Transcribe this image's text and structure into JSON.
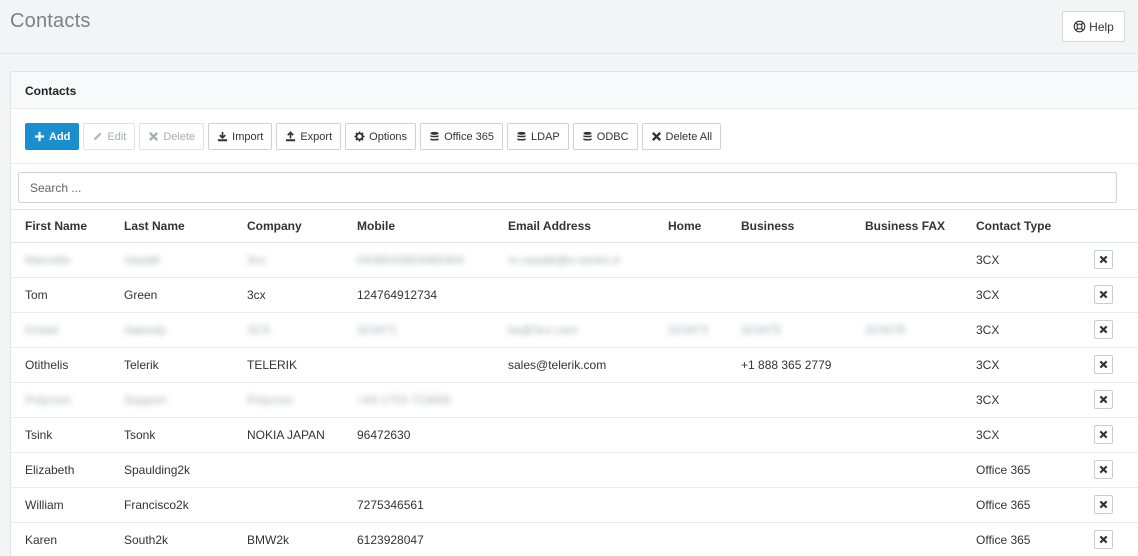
{
  "page": {
    "title": "Contacts",
    "help_label": "Help"
  },
  "panel": {
    "title": "Contacts"
  },
  "toolbar": {
    "add": "Add",
    "edit": "Edit",
    "delete": "Delete",
    "import": "Import",
    "export": "Export",
    "options": "Options",
    "office365": "Office 365",
    "ldap": "LDAP",
    "odbc": "ODBC",
    "delete_all": "Delete All"
  },
  "search": {
    "placeholder": "Search ..."
  },
  "table": {
    "columns": [
      "First Name",
      "Last Name",
      "Company",
      "Mobile",
      "Email Address",
      "Home",
      "Business",
      "Business FAX",
      "Contact Type"
    ],
    "rows": [
      {
        "blurred": true,
        "cells": [
          "Marcello",
          "Vasatti",
          "3cx",
          "0438543653465464",
          "m.vasatti@e-works.it",
          "",
          "",
          "",
          "3CX"
        ]
      },
      {
        "blurred": false,
        "cells": [
          "Tom",
          "Green",
          "3cx",
          "124764912734",
          "",
          "",
          "",
          "",
          "3CX"
        ]
      },
      {
        "blurred": true,
        "cells": [
          "Kristel",
          "Aakesly",
          "3CX",
          "323471",
          "ka@3cx.com",
          "323473",
          "323475",
          "323478",
          "3CX"
        ]
      },
      {
        "blurred": false,
        "cells": [
          "Otithelis",
          "Telerik",
          "TELERIK",
          "",
          "sales@telerik.com",
          "",
          "+1 888 365 2779",
          "",
          "3CX"
        ]
      },
      {
        "blurred": true,
        "cells": [
          "Polycom",
          "Support",
          "Polycom",
          "+44 1753 723000",
          "",
          "",
          "",
          "",
          "3CX"
        ]
      },
      {
        "blurred": false,
        "cells": [
          "Tsink",
          "Tsonk",
          "NOKIA JAPAN",
          "96472630",
          "",
          "",
          "",
          "",
          "3CX"
        ]
      },
      {
        "blurred": false,
        "cells": [
          "Elizabeth",
          "Spaulding2k",
          "",
          "",
          "",
          "",
          "",
          "",
          "Office 365"
        ]
      },
      {
        "blurred": false,
        "cells": [
          "William",
          "Francisco2k",
          "",
          "7275346561",
          "",
          "",
          "",
          "",
          "Office 365"
        ]
      },
      {
        "blurred": false,
        "cells": [
          "Karen",
          "South2k",
          "BMW2k",
          "6123928047",
          "",
          "",
          "",
          "",
          "Office 365"
        ]
      }
    ]
  },
  "icons": {
    "help": "life-ring-icon",
    "add": "plus-icon",
    "edit": "pencil-icon",
    "delete": "times-icon",
    "import": "download-icon",
    "export": "upload-icon",
    "options": "gear-icon",
    "office365": "database-icon",
    "ldap": "database-icon",
    "odbc": "database-icon",
    "delete_all": "times-icon",
    "row_delete": "times-icon"
  },
  "colors": {
    "primary": "#1a8fd0",
    "title": "#7a8288",
    "background": "#f3f4f5"
  }
}
